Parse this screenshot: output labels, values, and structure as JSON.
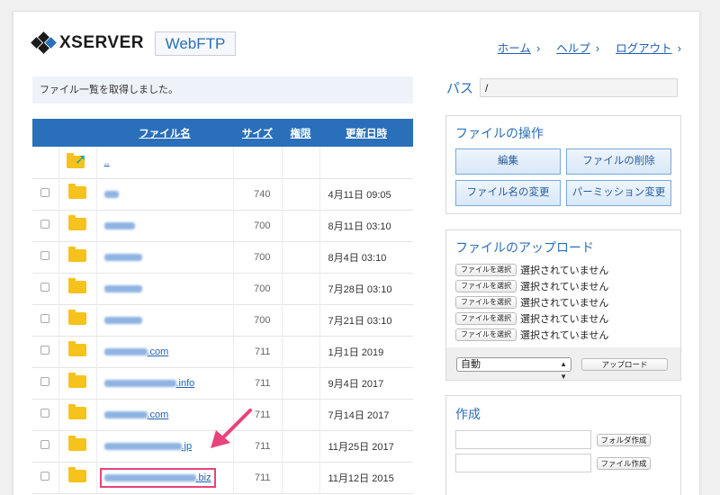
{
  "header": {
    "logo_text": "XSERVER",
    "app_name": "WebFTP",
    "nav": [
      {
        "label": "ホーム"
      },
      {
        "label": "ヘルプ"
      },
      {
        "label": "ログアウト"
      }
    ]
  },
  "status_message": "ファイル一覧を取得しました。",
  "file_table": {
    "columns": {
      "name": "ファイル名",
      "size": "サイズ",
      "permission": "権限",
      "updated": "更新日時"
    },
    "parent_link": "..",
    "rows": [
      {
        "name_suffix": "",
        "perm": "740",
        "date": "4月11日 09:05"
      },
      {
        "name_suffix": "",
        "perm": "700",
        "date": "8月11日 03:10"
      },
      {
        "name_suffix": "",
        "perm": "700",
        "date": "8月4日 03:10"
      },
      {
        "name_suffix": "",
        "perm": "700",
        "date": "7月28日 03:10"
      },
      {
        "name_suffix": "",
        "perm": "700",
        "date": "7月21日 03:10"
      },
      {
        "name_suffix": ".com",
        "perm": "711",
        "date": "1月1日 2019"
      },
      {
        "name_suffix": ".info",
        "perm": "711",
        "date": "9月4日 2017"
      },
      {
        "name_suffix": ".com",
        "perm": "711",
        "date": "7月14日 2017"
      },
      {
        "name_suffix": ".jp",
        "perm": "711",
        "date": "11月25日 2017"
      },
      {
        "name_suffix": ".biz",
        "perm": "711",
        "date": "11月12日 2015"
      }
    ]
  },
  "path": {
    "label": "パス",
    "value": "/"
  },
  "file_ops": {
    "title": "ファイルの操作",
    "buttons": {
      "edit": "編集",
      "delete": "ファイルの削除",
      "rename": "ファイル名の変更",
      "permission": "パーミッション変更"
    }
  },
  "upload": {
    "title": "ファイルのアップロード",
    "choose_label": "ファイルを選択",
    "no_file": "選択されていません",
    "mode_value": "自動",
    "upload_label": "アップロード"
  },
  "create": {
    "title": "作成",
    "folder_button": "フォルダ作成",
    "file_button": "ファイル作成"
  },
  "colors": {
    "accent": "#2a6fb9",
    "highlight": "#e8437b",
    "folder": "#f6c21c"
  }
}
